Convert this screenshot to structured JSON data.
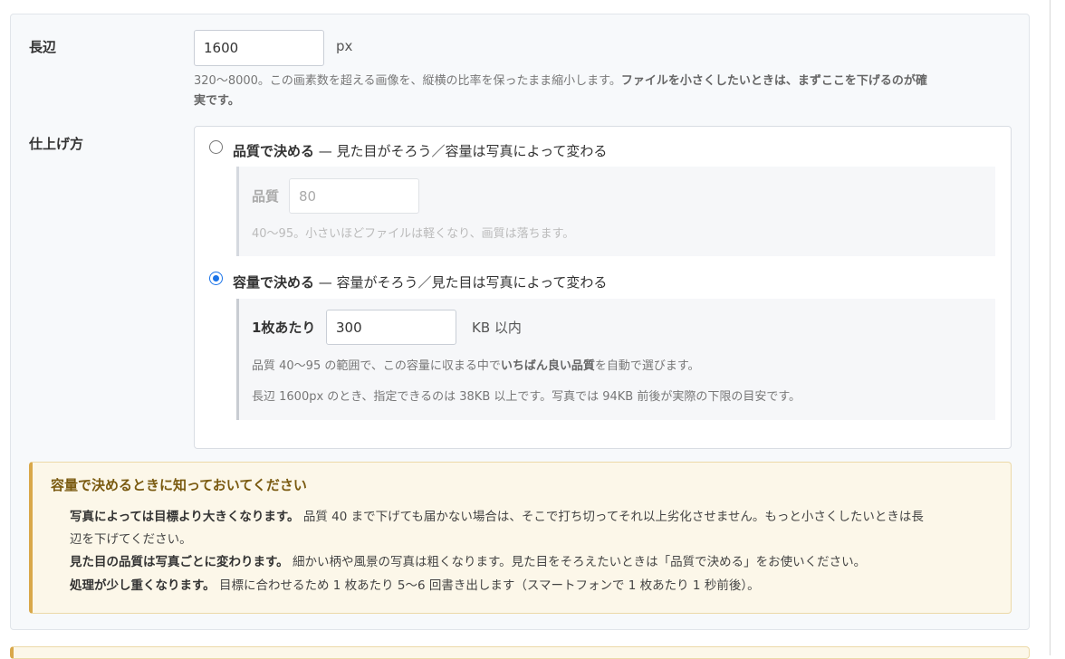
{
  "long_side": {
    "label": "長辺",
    "value": "1600",
    "unit": "px",
    "hint_text": "320〜8000。この画素数を超える画像を、縦横の比率を保ったまま縮小します。",
    "hint_bold": "ファイルを小さくしたいときは、まずここを下げるのが確",
    "hint_tail": "実です。"
  },
  "finish": {
    "label": "仕上げ方",
    "quality_option": {
      "title_bold": "品質で決める",
      "title_rest": " — 見た目がそろう／容量は写真によって変わる",
      "checked": false,
      "field_label": "品質",
      "field_value": "80",
      "hint": "40〜95。小さいほどファイルは軽くなり、画質は落ちます。"
    },
    "size_option": {
      "title_bold": "容量で決める",
      "title_rest": " — 容量がそろう／見た目は写真によって変わる",
      "checked": true,
      "field_label": "1枚あたり",
      "field_value": "300",
      "unit": "KB 以内",
      "hint1_a": "品質 40〜95 の範囲で、この容量に収まる中で",
      "hint1_bold": "いちばん良い品質",
      "hint1_b": "を自動で選びます。",
      "hint2": "長辺 1600px のとき、指定できるのは 38KB 以上です。写真では 94KB 前後が実際の下限の目安です。"
    }
  },
  "notice": {
    "title": "容量で決めるときに知っておいてください",
    "item1_bold": "写真によっては目標より大きくなります。",
    "item1_text": " 品質 40 まで下げても届かない場合は、そこで打ち切ってそれ以上劣化させません。もっと小さくしたいときは長",
    "item1_tail": "辺を下げてください。",
    "item2_bold": "見た目の品質は写真ごとに変わります。",
    "item2_text": " 細かい柄や風景の写真は粗くなります。見た目をそろえたいときは「品質で決める」をお使いください。",
    "item3_bold": "処理が少し重くなります。",
    "item3_text": " 目標に合わせるため 1 枚あたり 5〜6 回書き出します（スマートフォンで 1 枚あたり 1 秒前後）。"
  },
  "colors": {
    "accent": "#1a73e8",
    "notice_border": "#d9a84a",
    "notice_bg": "#fcf7e9"
  }
}
